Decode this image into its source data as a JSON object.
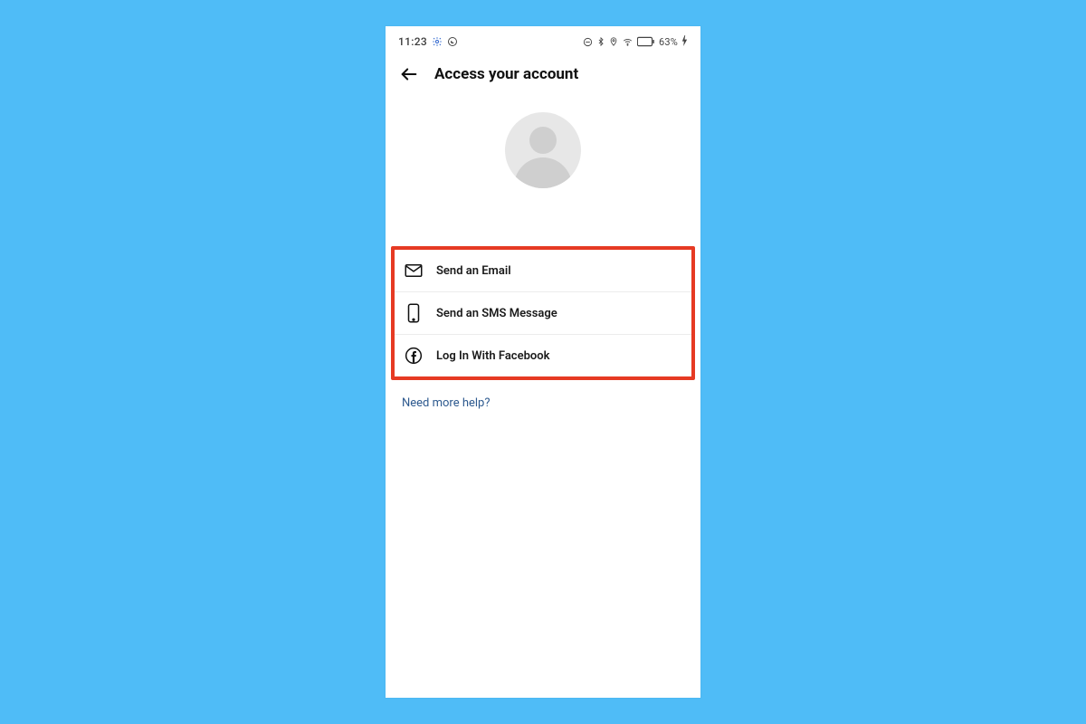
{
  "status_bar": {
    "time": "11:23",
    "icons_left": [
      "gear-icon",
      "whatsapp-icon"
    ],
    "icons_right": [
      "dnd-icon",
      "bluetooth-icon",
      "location-icon",
      "wifi-icon",
      "battery-icon"
    ],
    "battery_text": "63%"
  },
  "header": {
    "title": "Access your account"
  },
  "options": [
    {
      "icon": "email-icon",
      "label": "Send an Email"
    },
    {
      "icon": "phone-icon",
      "label": "Send an SMS Message"
    },
    {
      "icon": "facebook-icon",
      "label": "Log In With Facebook"
    }
  ],
  "help_link": "Need more help?",
  "colors": {
    "page_bg": "#4fbcf7",
    "highlight_border": "#e63a23",
    "link": "#2e5a8f"
  }
}
